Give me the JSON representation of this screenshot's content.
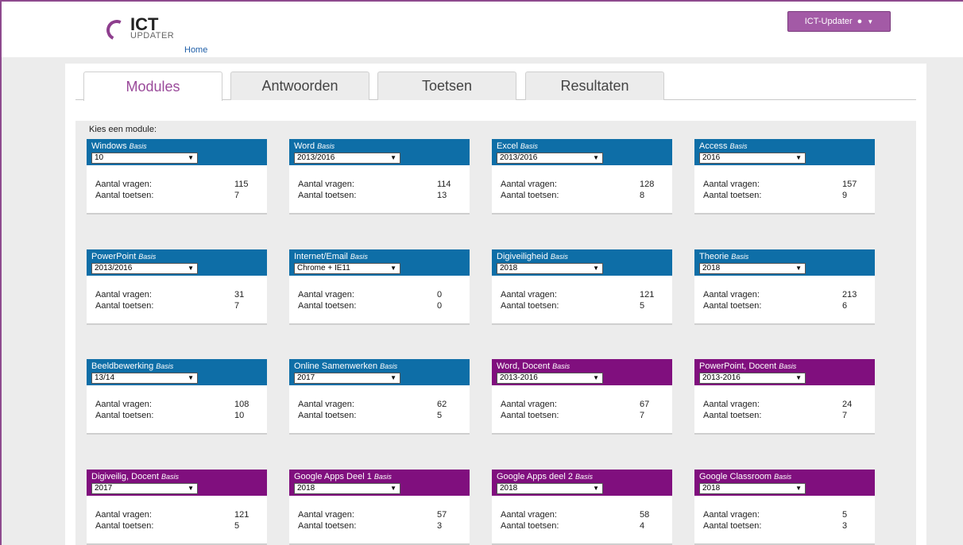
{
  "header": {
    "logo_title": "ICT",
    "logo_sub": "UPDATER",
    "home": "Home",
    "user_button": "ICT-Updater"
  },
  "tabs": [
    {
      "label": "Modules",
      "active": true
    },
    {
      "label": "Antwoorden",
      "active": false
    },
    {
      "label": "Toetsen",
      "active": false
    },
    {
      "label": "Resultaten",
      "active": false
    }
  ],
  "content": {
    "prompt": "Kies een module:",
    "stat_labels": {
      "vragen": "Aantal vragen:",
      "toetsen": "Aantal toetsen:"
    },
    "level": "Basis"
  },
  "modules": [
    {
      "name": "Windows",
      "version": "10",
      "vragen": "115",
      "toetsen": "7",
      "color": "blue"
    },
    {
      "name": "Word",
      "version": "2013/2016",
      "vragen": "114",
      "toetsen": "13",
      "color": "blue"
    },
    {
      "name": "Excel",
      "version": "2013/2016",
      "vragen": "128",
      "toetsen": "8",
      "color": "blue"
    },
    {
      "name": "Access",
      "version": "2016",
      "vragen": "157",
      "toetsen": "9",
      "color": "blue"
    },
    {
      "name": "PowerPoint",
      "version": "2013/2016",
      "vragen": "31",
      "toetsen": "7",
      "color": "blue"
    },
    {
      "name": "Internet/Email",
      "version": "Chrome + IE11",
      "vragen": "0",
      "toetsen": "0",
      "color": "blue"
    },
    {
      "name": "Digiveiligheid",
      "version": "2018",
      "vragen": "121",
      "toetsen": "5",
      "color": "blue"
    },
    {
      "name": "Theorie",
      "version": "2018",
      "vragen": "213",
      "toetsen": "6",
      "color": "blue"
    },
    {
      "name": "Beeldbewerking",
      "version": "13/14",
      "vragen": "108",
      "toetsen": "10",
      "color": "blue"
    },
    {
      "name": "Online Samenwerken",
      "version": "2017",
      "vragen": "62",
      "toetsen": "5",
      "color": "blue"
    },
    {
      "name": "Word, Docent",
      "version": "2013-2016",
      "vragen": "67",
      "toetsen": "7",
      "color": "purple"
    },
    {
      "name": "PowerPoint, Docent",
      "version": "2013-2016",
      "vragen": "24",
      "toetsen": "7",
      "color": "purple"
    },
    {
      "name": "Digiveilig, Docent",
      "version": "2017",
      "vragen": "121",
      "toetsen": "5",
      "color": "purple"
    },
    {
      "name": "Google Apps Deel 1",
      "version": "2018",
      "vragen": "57",
      "toetsen": "3",
      "color": "purple"
    },
    {
      "name": "Google Apps deel 2",
      "version": "2018",
      "vragen": "58",
      "toetsen": "4",
      "color": "purple"
    },
    {
      "name": "Google Classroom",
      "version": "2018",
      "vragen": "5",
      "toetsen": "3",
      "color": "purple"
    }
  ],
  "colors": {
    "blue": "#0e6ea7",
    "purple": "#800f7e",
    "accent": "#a35aa6"
  }
}
